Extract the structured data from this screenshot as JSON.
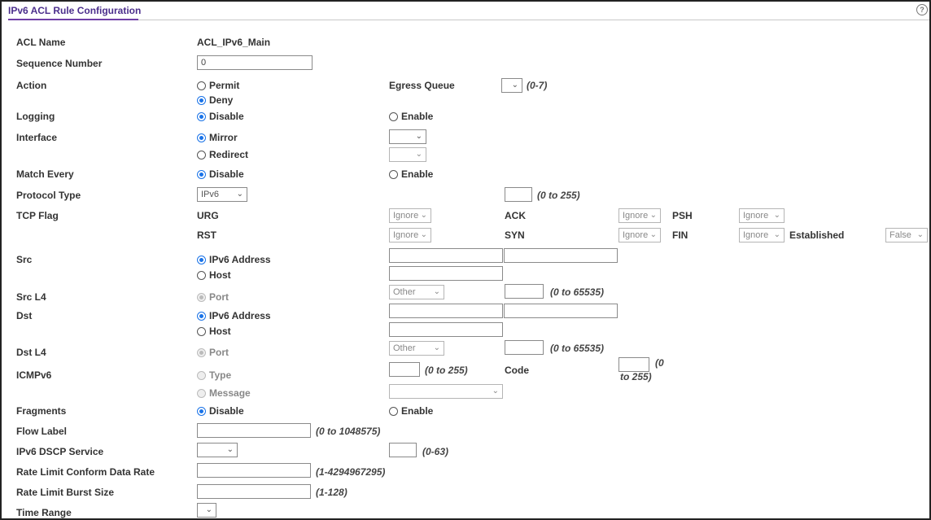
{
  "header": {
    "title": "IPv6 ACL Rule Configuration",
    "help_glyph": "?"
  },
  "labels": {
    "acl_name": "ACL Name",
    "sequence_number": "Sequence Number",
    "action": "Action",
    "logging": "Logging",
    "interface": "Interface",
    "match_every": "Match Every",
    "protocol_type": "Protocol Type",
    "tcp_flag": "TCP Flag",
    "src": "Src",
    "src_l4": "Src L4",
    "dst": "Dst",
    "dst_l4": "Dst L4",
    "icmpv6": "ICMPv6",
    "fragments": "Fragments",
    "flow_label": "Flow Label",
    "ipv6_dscp_service": "IPv6 DSCP Service",
    "rate_limit_conform": "Rate Limit Conform Data Rate",
    "rate_limit_burst": "Rate Limit Burst Size",
    "time_range": "Time Range"
  },
  "values": {
    "acl_name": "ACL_IPv6_Main",
    "sequence_number": "0"
  },
  "options": {
    "permit": "Permit",
    "deny": "Deny",
    "disable": "Disable",
    "enable": "Enable",
    "mirror": "Mirror",
    "redirect": "Redirect",
    "ipv6_address": "IPv6 Address",
    "host": "Host",
    "port": "Port",
    "type": "Type",
    "message": "Message"
  },
  "egress_queue": {
    "label": "Egress Queue",
    "hint": "(0-7)"
  },
  "protocol": {
    "selected": "IPv6",
    "hint": "(0 to 255)"
  },
  "tcp_flags": {
    "urg": "URG",
    "ack": "ACK",
    "psh": "PSH",
    "rst": "RST",
    "syn": "SYN",
    "fin": "FIN",
    "established": "Established",
    "ignore": "Ignore",
    "false": "False"
  },
  "l4": {
    "other": "Other",
    "hint": "(0 to 65535)"
  },
  "icmp": {
    "type_hint": "(0 to 255)",
    "code_label": "Code",
    "code_hint_1": "(0",
    "code_hint_2": "to 255)"
  },
  "hints": {
    "flow_label": "(0 to 1048575)",
    "dscp": "(0-63)",
    "conform": "(1-4294967295)",
    "burst": "(1-128)"
  },
  "icons": {
    "chevron": "⌄",
    "help": "help-icon",
    "radio": "radio-icon",
    "dropdown": "chevron-down-icon"
  },
  "colors": {
    "title": "#4b2e8c",
    "accent": "#6f3fa6",
    "radio_on": "#1a73e8"
  }
}
